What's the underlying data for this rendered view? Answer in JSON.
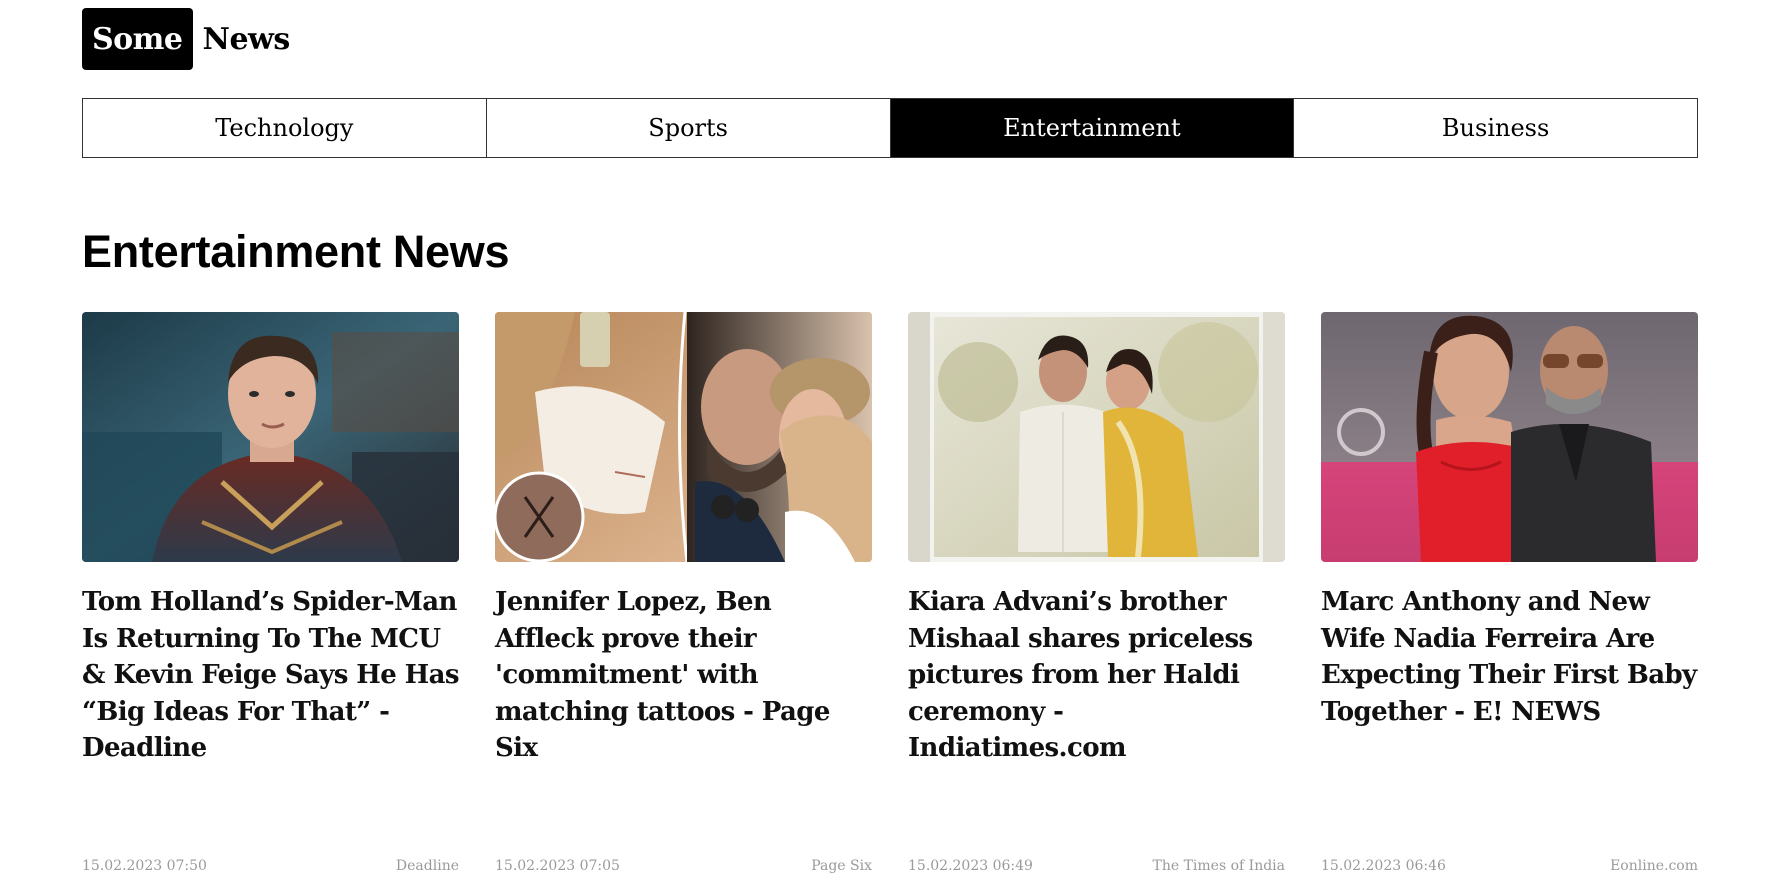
{
  "logo": {
    "box_text": "Some",
    "text": "News"
  },
  "tabs": [
    {
      "label": "Technology",
      "active": false
    },
    {
      "label": "Sports",
      "active": false
    },
    {
      "label": "Entertainment",
      "active": true
    },
    {
      "label": "Business",
      "active": false
    }
  ],
  "section": {
    "title": "Entertainment News"
  },
  "articles": [
    {
      "headline": "Tom Holland’s Spider-Man Is Returning To The MCU & Kevin Feige Says He Has “Big Ideas For That” - Deadline",
      "date": "15.02.2023 07:50",
      "source": "Deadline"
    },
    {
      "headline": "Jennifer Lopez, Ben Affleck prove their 'commitment' with matching tattoos - Page Six",
      "date": "15.02.2023 07:05",
      "source": "Page Six"
    },
    {
      "headline": "Kiara Advani’s brother Mishaal shares priceless pictures from her Haldi ceremony - Indiatimes.com",
      "date": "15.02.2023 06:49",
      "source": "The Times of India"
    },
    {
      "headline": "Marc Anthony and New Wife Nadia Ferreira Are Expecting Their First Baby Together - E! NEWS",
      "date": "15.02.2023 06:46",
      "source": "Eonline.com"
    }
  ]
}
